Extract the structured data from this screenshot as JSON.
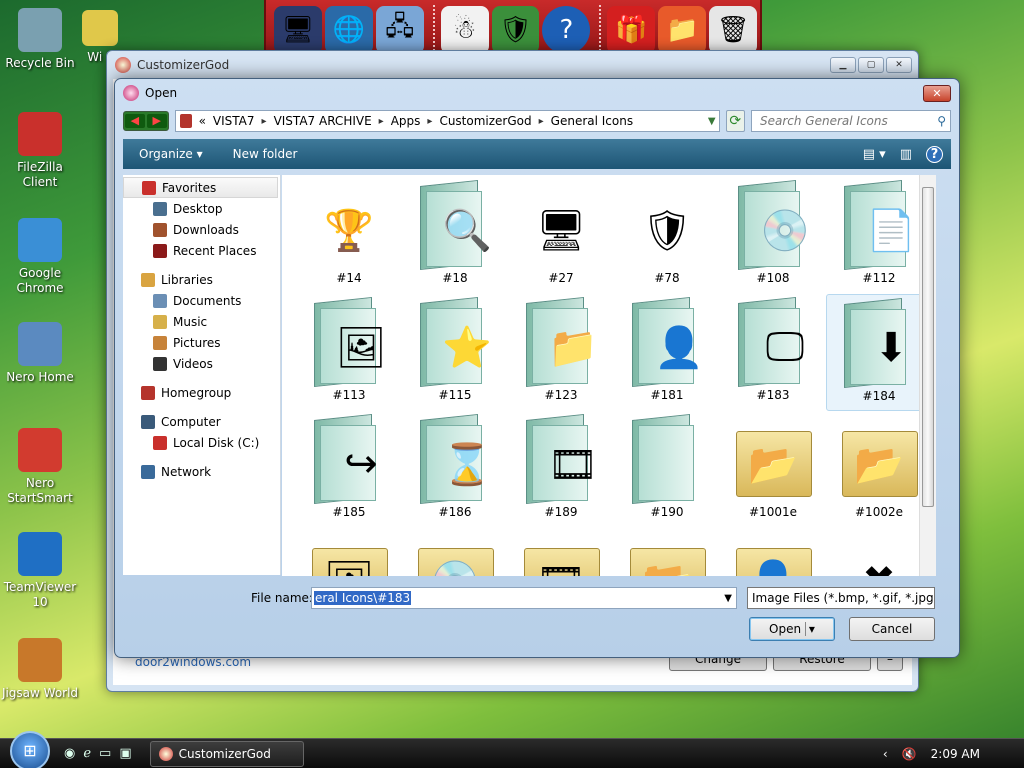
{
  "desktop": {
    "icons": [
      {
        "label": "Recycle Bin",
        "color": "#7aa0b0"
      },
      {
        "label": "FileZilla Client",
        "color": "#c9302c"
      },
      {
        "label": "Google Chrome",
        "color": "#3a8fd6"
      },
      {
        "label": "Nero Home",
        "color": "#5b8ac0"
      },
      {
        "label": "Nero StartSmart",
        "color": "#d23b2f"
      },
      {
        "label": "TeamViewer 10",
        "color": "#1f6fc4"
      },
      {
        "label": "Jigsaw World",
        "color": "#c8782a"
      }
    ],
    "partial_icon_label": "Wi L"
  },
  "toolbar": {
    "icons": [
      "computer-icon",
      "globe-icon",
      "network-icon",
      "snowman-icon",
      "shield-icon",
      "help-icon",
      "gift-icon",
      "folder-icon",
      "recycle-icon"
    ]
  },
  "background_window": {
    "title": "CustomizerGod",
    "link": "door2windows.com",
    "change_label": "Change",
    "restore_label": "Restore",
    "extra_label": "–"
  },
  "dialog": {
    "title": "Open",
    "breadcrumb": [
      "«",
      "VISTA7",
      "VISTA7 ARCHIVE",
      "Apps",
      "CustomizerGod",
      "General Icons"
    ],
    "search_placeholder": "Search General Icons",
    "organize_label": "Organize ▾",
    "new_folder_label": "New folder",
    "nav": {
      "favorites": {
        "label": "Favorites",
        "items": [
          "Desktop",
          "Downloads",
          "Recent Places"
        ]
      },
      "libraries": {
        "label": "Libraries",
        "items": [
          "Documents",
          "Music",
          "Pictures",
          "Videos"
        ]
      },
      "homegroup": "Homegroup",
      "computer": {
        "label": "Computer",
        "items": [
          "Local Disk (C:)"
        ]
      },
      "network": "Network"
    },
    "files": [
      {
        "name": "#14",
        "kind": "trophy",
        "glyph": "🏆"
      },
      {
        "name": "#18",
        "kind": "folder",
        "glyph": "🔍"
      },
      {
        "name": "#27",
        "kind": "device",
        "glyph": "🖥"
      },
      {
        "name": "#78",
        "kind": "shield",
        "glyph": "🛡"
      },
      {
        "name": "#108",
        "kind": "folder",
        "glyph": "💿"
      },
      {
        "name": "#112",
        "kind": "folder",
        "glyph": "📄"
      },
      {
        "name": "#113",
        "kind": "folder",
        "glyph": "🖼"
      },
      {
        "name": "#115",
        "kind": "folder",
        "glyph": "⭐"
      },
      {
        "name": "#123",
        "kind": "folder",
        "glyph": "📁"
      },
      {
        "name": "#181",
        "kind": "folder",
        "glyph": "👤"
      },
      {
        "name": "#183",
        "kind": "folder",
        "glyph": "🖵"
      },
      {
        "name": "#184",
        "kind": "folder",
        "glyph": "⬇"
      },
      {
        "name": "#185",
        "kind": "folder",
        "glyph": "↪"
      },
      {
        "name": "#186",
        "kind": "folder",
        "glyph": "⌛"
      },
      {
        "name": "#189",
        "kind": "folder",
        "glyph": "🎞"
      },
      {
        "name": "#190",
        "kind": "folder",
        "glyph": ""
      },
      {
        "name": "#1001e",
        "kind": "yellow",
        "glyph": "📂"
      },
      {
        "name": "#1002e",
        "kind": "yellow",
        "glyph": "📂"
      },
      {
        "name": "",
        "kind": "yellow",
        "glyph": "🖼"
      },
      {
        "name": "",
        "kind": "yellow",
        "glyph": "💿"
      },
      {
        "name": "",
        "kind": "yellow",
        "glyph": "🎞"
      },
      {
        "name": "",
        "kind": "yellow",
        "glyph": "📂"
      },
      {
        "name": "",
        "kind": "yellow",
        "glyph": "👤"
      },
      {
        "name": "",
        "kind": "plain",
        "glyph": "✖"
      }
    ],
    "selected_file": "#184",
    "file_name_label": "File name:",
    "file_name_value": "eral Icons\\#183",
    "file_type_value": "Image Files (*.bmp, *.gif, *.jpg,",
    "open_label": "Open",
    "cancel_label": "Cancel"
  },
  "taskbar": {
    "task_label": "CustomizerGod",
    "time": "2:09 AM"
  }
}
